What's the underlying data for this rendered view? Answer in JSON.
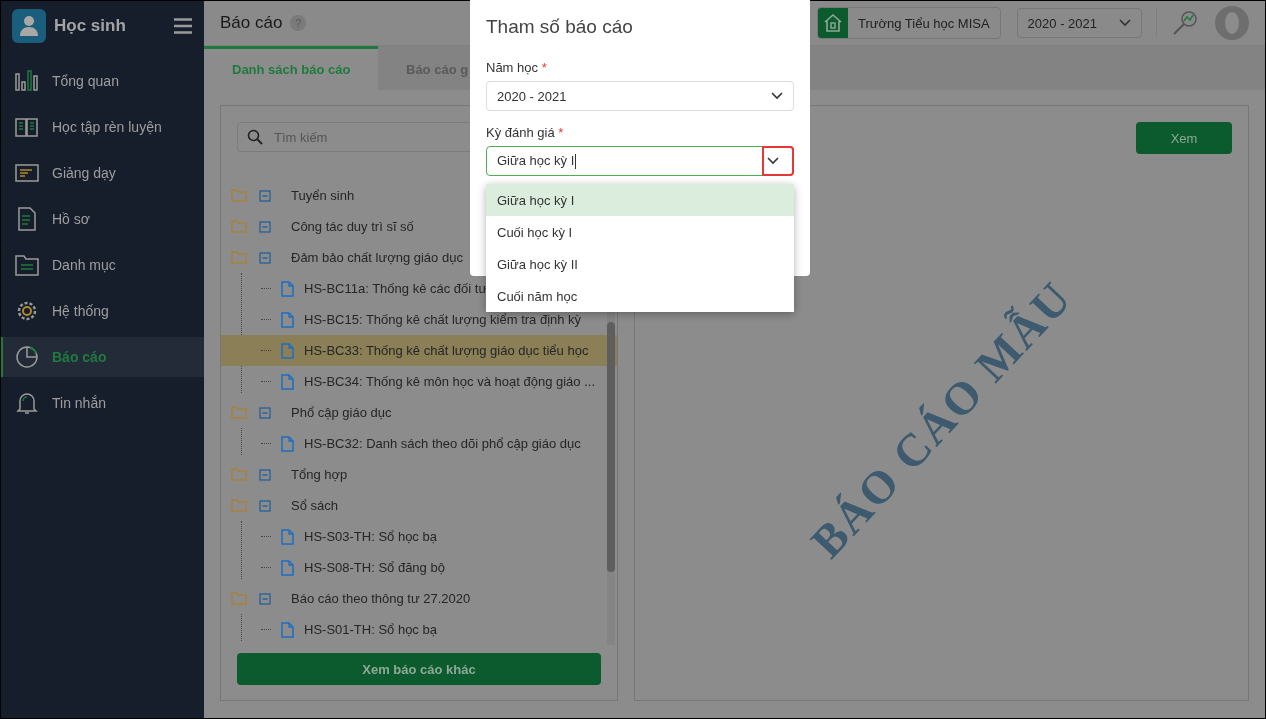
{
  "sidebar": {
    "title": "Học sinh",
    "items": [
      {
        "label": "Tổng quan",
        "selected": false
      },
      {
        "label": "Học tập rèn luyện",
        "selected": false
      },
      {
        "label": "Giảng dạy",
        "selected": false
      },
      {
        "label": "Hồ sơ",
        "selected": false
      },
      {
        "label": "Danh mục",
        "selected": false
      },
      {
        "label": "Hệ thống",
        "selected": false
      },
      {
        "label": "Báo cáo",
        "selected": true
      },
      {
        "label": "Tin nhắn",
        "selected": false
      }
    ]
  },
  "header": {
    "title": "Báo cáo",
    "help": "?",
    "school": "Trường Tiểu học MISA",
    "year": "2020 - 2021"
  },
  "tabs": [
    {
      "label": "Danh sách báo cáo",
      "selected": true
    },
    {
      "label": "Báo cáo g",
      "selected": false
    }
  ],
  "search": {
    "placeholder": "Tìm kiếm"
  },
  "tree": [
    {
      "label": "Tuyển sinh",
      "expanded": true
    },
    {
      "label": "Công tác duy trì sĩ số",
      "expanded": true
    },
    {
      "label": "Đảm bảo chất lượng giáo dục",
      "expanded": true,
      "children": [
        {
          "label": "HS-BC11a: Thống kê các đối tư",
          "selected": false
        },
        {
          "label": "HS-BC15: Thống kê chất lượng kiểm tra định kỳ",
          "selected": false
        },
        {
          "label": "HS-BC33: Thống kê chất lượng giáo dục tiểu học",
          "selected": true
        },
        {
          "label": "HS-BC34: Thống kê môn học và hoạt động giáo ...",
          "selected": false
        }
      ]
    },
    {
      "label": "Phổ cập giáo dục",
      "expanded": true,
      "children": [
        {
          "label": "HS-BC32: Danh sách theo dõi phổ cập giáo dục",
          "selected": false
        }
      ]
    },
    {
      "label": "Tổng hợp",
      "expanded": true
    },
    {
      "label": "Sổ sách",
      "expanded": true,
      "children": [
        {
          "label": "HS-S03-TH: Sổ học bạ",
          "selected": false
        },
        {
          "label": "HS-S08-TH: Sổ đăng bộ",
          "selected": false
        }
      ]
    },
    {
      "label": "Báo cáo theo thông tư 27.2020",
      "expanded": true,
      "children": [
        {
          "label": "HS-S01-TH: Sổ học bạ",
          "selected": false
        }
      ]
    }
  ],
  "more_button": "Xem báo cáo khác",
  "preview": {
    "button": "Xem",
    "sample_text": "BÁO CÁO MẪU"
  },
  "dialog": {
    "title": "Tham số báo cáo",
    "fields": [
      {
        "label": "Năm học",
        "required": "*",
        "value": "2020 - 2021",
        "open": false
      },
      {
        "label": "Kỳ đánh giá",
        "required": "*",
        "value": "Giữa học kỳ I",
        "open": true
      }
    ],
    "options": [
      {
        "label": "Giữa học kỳ I",
        "selected": true
      },
      {
        "label": "Cuối học kỳ I",
        "selected": false
      },
      {
        "label": "Giữa học kỳ II",
        "selected": false
      },
      {
        "label": "Cuối năm học",
        "selected": false
      }
    ]
  }
}
